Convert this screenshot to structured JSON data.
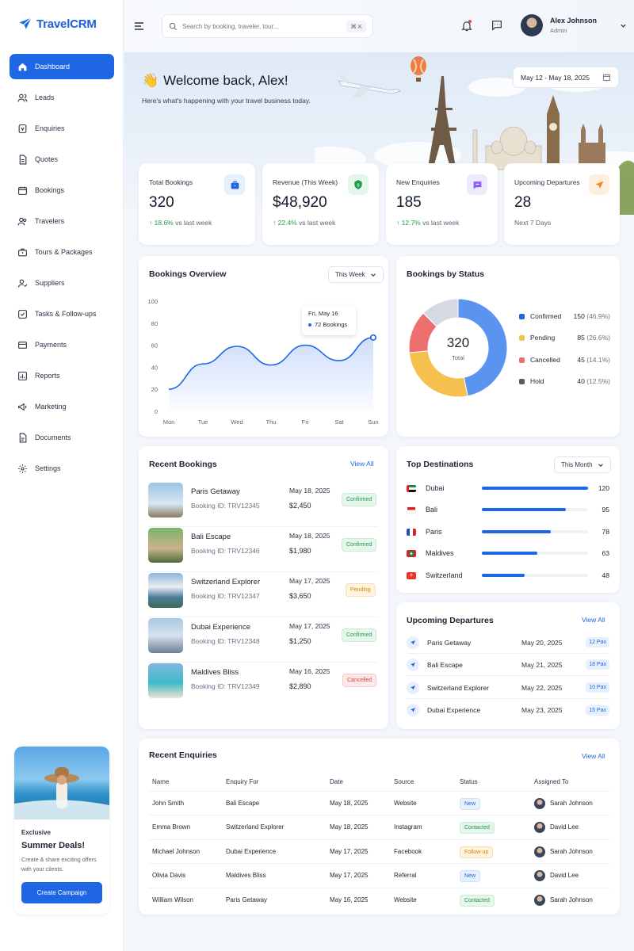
{
  "app": {
    "name": "TravelCRM"
  },
  "sidebar": {
    "items": [
      {
        "label": "Dashboard"
      },
      {
        "label": "Leads"
      },
      {
        "label": "Enquiries"
      },
      {
        "label": "Quotes"
      },
      {
        "label": "Bookings"
      },
      {
        "label": "Travelers"
      },
      {
        "label": "Tours & Packages"
      },
      {
        "label": "Suppliers"
      },
      {
        "label": "Tasks & Follow-ups"
      },
      {
        "label": "Payments"
      },
      {
        "label": "Reports"
      },
      {
        "label": "Marketing"
      },
      {
        "label": "Documents"
      },
      {
        "label": "Settings"
      }
    ],
    "promo": {
      "kicker": "Exclusive",
      "title": "Summer Deals!",
      "desc": "Create & share exciting offers with your clients.",
      "button": "Create Campaign"
    }
  },
  "header": {
    "search_placeholder": "Search by booking, traveler, tour...",
    "shortcut": "⌘ K",
    "user_name": "Alex Johnson",
    "user_role": "Admin"
  },
  "hero": {
    "welcome": "Welcome back, Alex!",
    "subtitle": "Here's what's happening with your travel business today.",
    "date_range": "May 12 - May 18, 2025"
  },
  "stats": [
    {
      "label": "Total Bookings",
      "value": "320",
      "change": "18.6%",
      "suffix": "vs last week"
    },
    {
      "label": "Revenue (This Week)",
      "value": "$48,920",
      "change": "22.4%",
      "suffix": "vs last week"
    },
    {
      "label": "New Enquiries",
      "value": "185",
      "change": "12.7%",
      "suffix": "vs last week"
    },
    {
      "label": "Upcoming Departures",
      "value": "28",
      "suffix": "Next 7 Days"
    }
  ],
  "overview": {
    "title": "Bookings Overview",
    "period": "This Week",
    "tooltip_date": "Fri, May 16",
    "tooltip_value": "72 Bookings"
  },
  "status": {
    "title": "Bookings by Status",
    "total": "320",
    "total_label": "Total",
    "items": [
      {
        "name": "Confirmed",
        "value": "150",
        "pct": "(46.9%)",
        "color": "#5b93f0"
      },
      {
        "name": "Pending",
        "value": "85",
        "pct": "(26.6%)",
        "color": "#f6c04f"
      },
      {
        "name": "Cancelled",
        "value": "45",
        "pct": "(14.1%)",
        "color": "#ee6f6f"
      },
      {
        "name": "Hold",
        "value": "40",
        "pct": "(12.5%)",
        "color": "#d5d9e0"
      }
    ]
  },
  "chart_data": [
    {
      "type": "area",
      "title": "Bookings Overview",
      "categories": [
        "Mon",
        "Tue",
        "Wed",
        "Thu",
        "Fri",
        "Sat",
        "Sun"
      ],
      "values": [
        20,
        43,
        59,
        42,
        60,
        46,
        67
      ],
      "ylim": [
        0,
        100
      ],
      "yticks": [
        0,
        20,
        40,
        60,
        80,
        100
      ],
      "grid": false
    },
    {
      "type": "pie",
      "title": "Bookings by Status",
      "categories": [
        "Confirmed",
        "Pending",
        "Cancelled",
        "Hold"
      ],
      "values": [
        150,
        85,
        45,
        40
      ],
      "colors": [
        "#5b93f0",
        "#f6c04f",
        "#ee6f6f",
        "#d5d9e0"
      ]
    }
  ],
  "recent_bookings": {
    "title": "Recent Bookings",
    "view_all": "View All",
    "rows": [
      {
        "name": "Paris Getaway",
        "id": "Booking ID: TRV12345",
        "date": "May 18, 2025",
        "price": "$2,450",
        "status": "Confirmed"
      },
      {
        "name": "Bali Escape",
        "id": "Booking ID: TRV12346",
        "date": "May 18, 2025",
        "price": "$1,980",
        "status": "Confirmed"
      },
      {
        "name": "Switzerland Explorer",
        "id": "Booking ID: TRV12347",
        "date": "May 17, 2025",
        "price": "$3,650",
        "status": "Pending"
      },
      {
        "name": "Dubai Experience",
        "id": "Booking ID: TRV12348",
        "date": "May 17, 2025",
        "price": "$1,250",
        "status": "Confirmed"
      },
      {
        "name": "Maldives Bliss",
        "id": "Booking ID: TRV12349",
        "date": "May 16, 2025",
        "price": "$2,890",
        "status": "Cancelled"
      }
    ]
  },
  "destinations": {
    "title": "Top Destinations",
    "period": "This Month",
    "items": [
      {
        "name": "Dubai",
        "value": 120
      },
      {
        "name": "Bali",
        "value": 95
      },
      {
        "name": "Paris",
        "value": 78
      },
      {
        "name": "Maldives",
        "value": 63
      },
      {
        "name": "Switzerland",
        "value": 48
      }
    ]
  },
  "departures": {
    "title": "Upcoming Departures",
    "view_all": "View All",
    "items": [
      {
        "name": "Paris Getaway",
        "date": "May 20, 2025",
        "pax": "12 Pax"
      },
      {
        "name": "Bali Escape",
        "date": "May 21, 2025",
        "pax": "18 Pax"
      },
      {
        "name": "Switzerland Explorer",
        "date": "May 22, 2025",
        "pax": "10 Pax"
      },
      {
        "name": "Dubai Experience",
        "date": "May 23, 2025",
        "pax": "15 Pax"
      }
    ]
  },
  "enquiries": {
    "title": "Recent Enquiries",
    "view_all": "View All",
    "columns": [
      "Name",
      "Enquiry For",
      "Date",
      "Source",
      "Status",
      "Assigned To"
    ],
    "rows": [
      {
        "name": "John Smith",
        "for": "Bali Escape",
        "date": "May 18, 2025",
        "source": "Website",
        "status": "New",
        "assigned": "Sarah Johnson"
      },
      {
        "name": "Emma Brown",
        "for": "Switzerland Explorer",
        "date": "May 18, 2025",
        "source": "Instagram",
        "status": "Contacted",
        "assigned": "David Lee"
      },
      {
        "name": "Michael Johnson",
        "for": "Dubai Experience",
        "date": "May 17, 2025",
        "source": "Facebook",
        "status": "Follow-up",
        "assigned": "Sarah Johnson"
      },
      {
        "name": "Olivia Davis",
        "for": "Maldives Bliss",
        "date": "May 17, 2025",
        "source": "Referral",
        "status": "New",
        "assigned": "David Lee"
      },
      {
        "name": "William Wilson",
        "for": "Paris Getaway",
        "date": "May 16, 2025",
        "source": "Website",
        "status": "Contacted",
        "assigned": "Sarah Johnson"
      }
    ]
  }
}
